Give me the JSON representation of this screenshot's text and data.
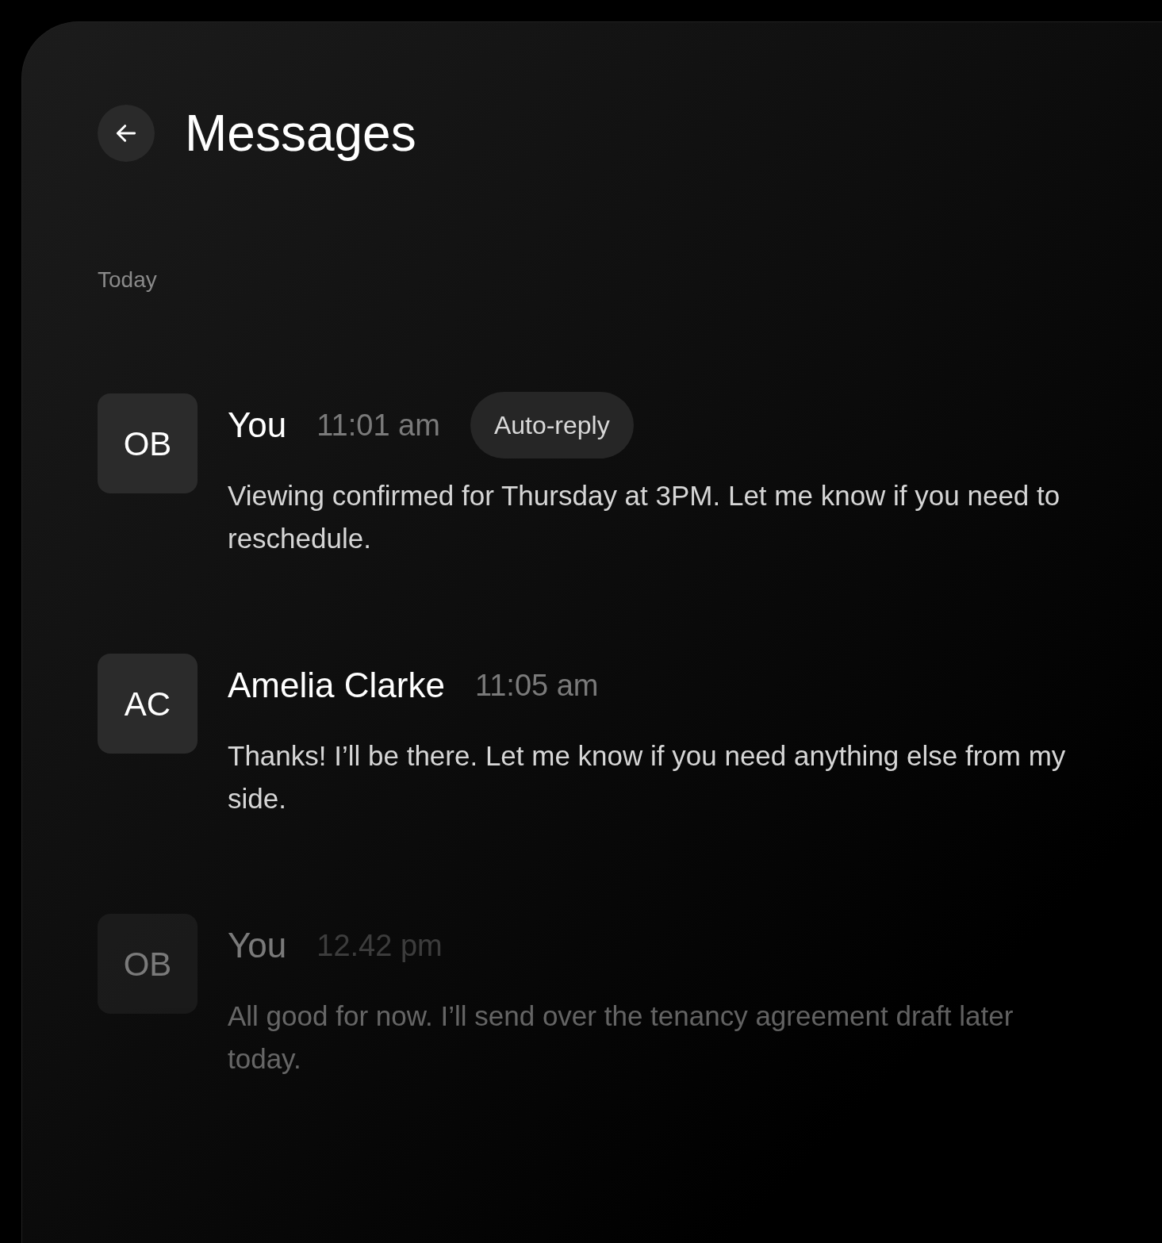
{
  "header": {
    "title": "Messages"
  },
  "section_label": "Today",
  "messages": [
    {
      "initials": "OB",
      "sender": "You",
      "time": "11:01 am",
      "badge": "Auto-reply",
      "text": "Viewing confirmed for Thursday at 3PM. Let me know if you need to reschedule.",
      "dimmed": false
    },
    {
      "initials": "AC",
      "sender": "Amelia Clarke",
      "time": "11:05 am",
      "text": "Thanks! I’ll be there. Let me know if you need anything else from my side.",
      "dimmed": false
    },
    {
      "initials": "OB",
      "sender": "You",
      "time": "12.42 pm",
      "text": "All good for now. I’ll send over the tenancy agreement draft later today.",
      "dimmed": true
    }
  ]
}
